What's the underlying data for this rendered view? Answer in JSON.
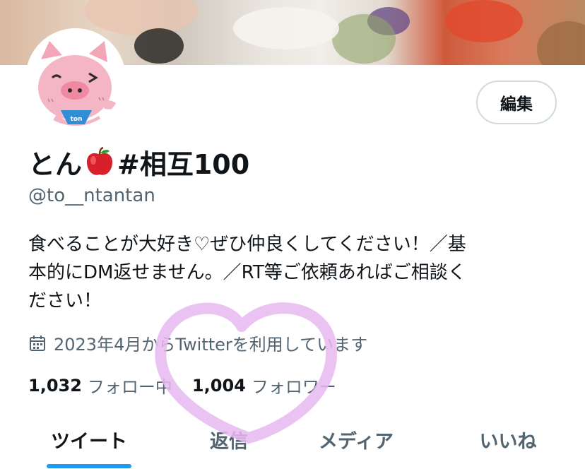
{
  "profile": {
    "display_name": "とん",
    "display_name_suffix": "#相互100",
    "handle": "@to__ntantan",
    "bio_lines": [
      "食べることが大好き♡ぜひ仲良くしてください！／基",
      "本的にDM返せません。／RT等ご依頼あればご相談く",
      "ださい！"
    ],
    "joined": "2023年4月からTwitterを利用しています",
    "avatar_badge": "ton"
  },
  "actions": {
    "edit_label": "編集"
  },
  "stats": {
    "following_count": "1,032",
    "following_label": "フォロー中",
    "followers_count": "1,004",
    "followers_label": "フォロワー"
  },
  "tabs": [
    {
      "label": "ツイート",
      "active": true
    },
    {
      "label": "返信",
      "active": false
    },
    {
      "label": "メディア",
      "active": false
    },
    {
      "label": "いいね",
      "active": false
    }
  ],
  "icons": {
    "calendar": "calendar-icon",
    "apple": "apple-emoji-icon"
  },
  "colors": {
    "accent": "#1d9bf0",
    "secondary_text": "#536471",
    "primary_text": "#0f1419",
    "heart_doodle": "#e7b8f0"
  }
}
